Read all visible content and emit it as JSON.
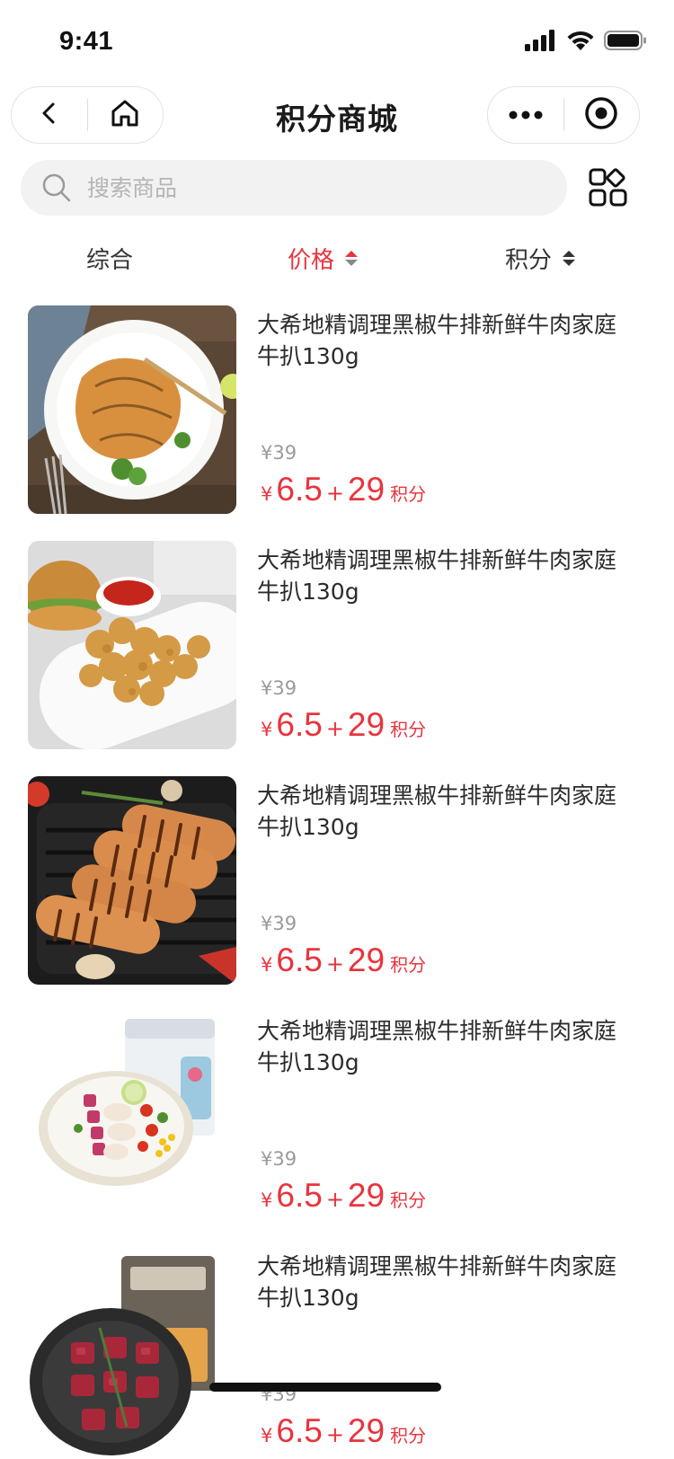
{
  "status_bar": {
    "time": "9:41"
  },
  "nav": {
    "title": "积分商城"
  },
  "search": {
    "placeholder": "搜索商品"
  },
  "sort": [
    {
      "label": "综合",
      "active": false,
      "sortable": false
    },
    {
      "label": "价格",
      "active": true,
      "sortable": true
    },
    {
      "label": "积分",
      "active": false,
      "sortable": true
    }
  ],
  "colors": {
    "accent": "#e8343e",
    "text": "#2b2b2b",
    "muted": "#9a9a9a",
    "search_bg": "#f2f2f2"
  },
  "products": [
    {
      "title": "大希地精调理黑椒牛排新鲜牛肉家庭牛扒130g",
      "original_price": "¥39",
      "yen": "¥",
      "cash": "6.5",
      "plus": "+",
      "points": "29",
      "points_unit": "积分",
      "image": "grilled-chicken-steak"
    },
    {
      "title": "大希地精调理黑椒牛排新鲜牛肉家庭牛扒130g",
      "original_price": "¥39",
      "yen": "¥",
      "cash": "6.5",
      "plus": "+",
      "points": "29",
      "points_unit": "积分",
      "image": "chicken-nuggets"
    },
    {
      "title": "大希地精调理黑椒牛排新鲜牛肉家庭牛扒130g",
      "original_price": "¥39",
      "yen": "¥",
      "cash": "6.5",
      "plus": "+",
      "points": "29",
      "points_unit": "积分",
      "image": "grilled-sausages"
    },
    {
      "title": "大希地精调理黑椒牛排新鲜牛肉家庭牛扒130g",
      "original_price": "¥39",
      "yen": "¥",
      "cash": "6.5",
      "plus": "+",
      "points": "29",
      "points_unit": "积分",
      "image": "chicken-breast-salad"
    },
    {
      "title": "大希地精调理黑椒牛排新鲜牛肉家庭牛扒130g",
      "original_price": "¥39",
      "yen": "¥",
      "cash": "6.5",
      "plus": "+",
      "points": "29",
      "points_unit": "积分",
      "image": "beef-cubes"
    }
  ]
}
